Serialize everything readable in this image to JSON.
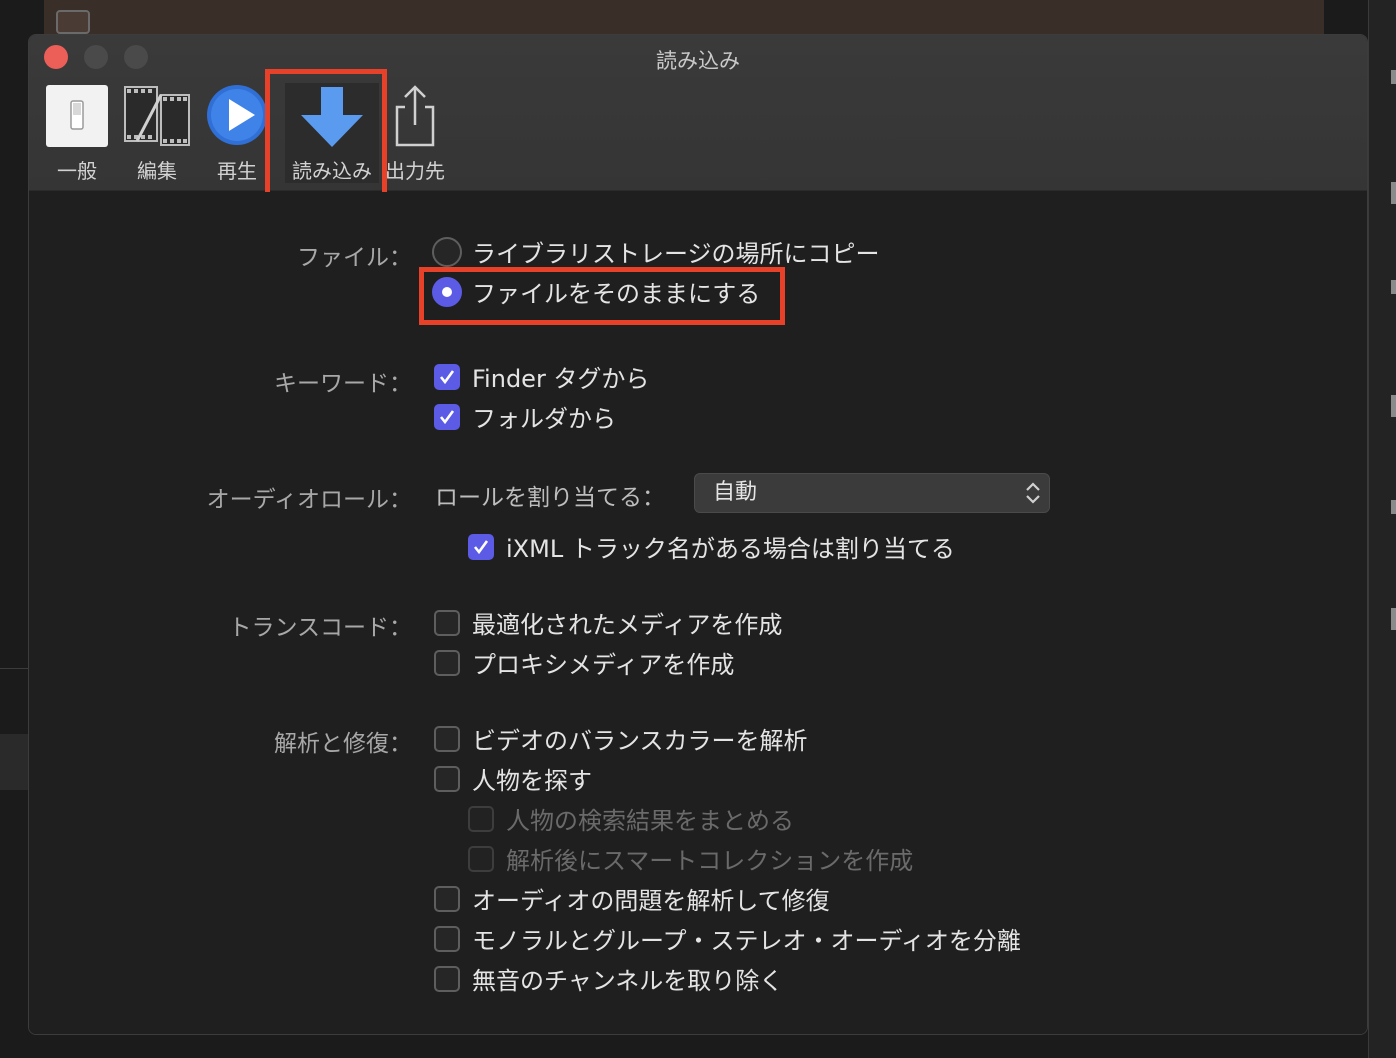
{
  "window": {
    "title": "読み込み"
  },
  "toolbar": {
    "items": [
      {
        "label": "一般"
      },
      {
        "label": "編集"
      },
      {
        "label": "再生"
      },
      {
        "label": "読み込み"
      },
      {
        "label": "出力先"
      }
    ],
    "selected": "読み込み"
  },
  "sections": {
    "file": {
      "label": "ファイル：",
      "options": [
        {
          "label": "ライブラリストレージの場所にコピー",
          "selected": false
        },
        {
          "label": "ファイルをそのままにする",
          "selected": true
        }
      ]
    },
    "keywords": {
      "label": "キーワード：",
      "options": [
        {
          "label": "Finder タグから",
          "checked": true
        },
        {
          "label": "フォルダから",
          "checked": true
        }
      ]
    },
    "audio_roles": {
      "label": "オーディオロール：",
      "assign_label": "ロールを割り当てる：",
      "select_value": "自動",
      "ixml": {
        "label": "iXML トラック名がある場合は割り当てる",
        "checked": true
      }
    },
    "transcode": {
      "label": "トランスコード：",
      "options": [
        {
          "label": "最適化されたメディアを作成",
          "checked": false
        },
        {
          "label": "プロキシメディアを作成",
          "checked": false
        }
      ]
    },
    "analyze": {
      "label": "解析と修復：",
      "options": [
        {
          "label": "ビデオのバランスカラーを解析",
          "checked": false
        },
        {
          "label": "人物を探す",
          "checked": false
        },
        {
          "label": "人物の検索結果をまとめる",
          "checked": false,
          "disabled": true
        },
        {
          "label": "解析後にスマートコレクションを作成",
          "checked": false,
          "disabled": true
        },
        {
          "label": "オーディオの問題を解析して修復",
          "checked": false
        },
        {
          "label": "モノラルとグループ・ステレオ・オーディオを分離",
          "checked": false
        },
        {
          "label": "無音のチャンネルを取り除く",
          "checked": false
        }
      ]
    }
  },
  "colors": {
    "accent": "#5b5be6",
    "highlight": "#e8412a",
    "close": "#ec5f59"
  }
}
